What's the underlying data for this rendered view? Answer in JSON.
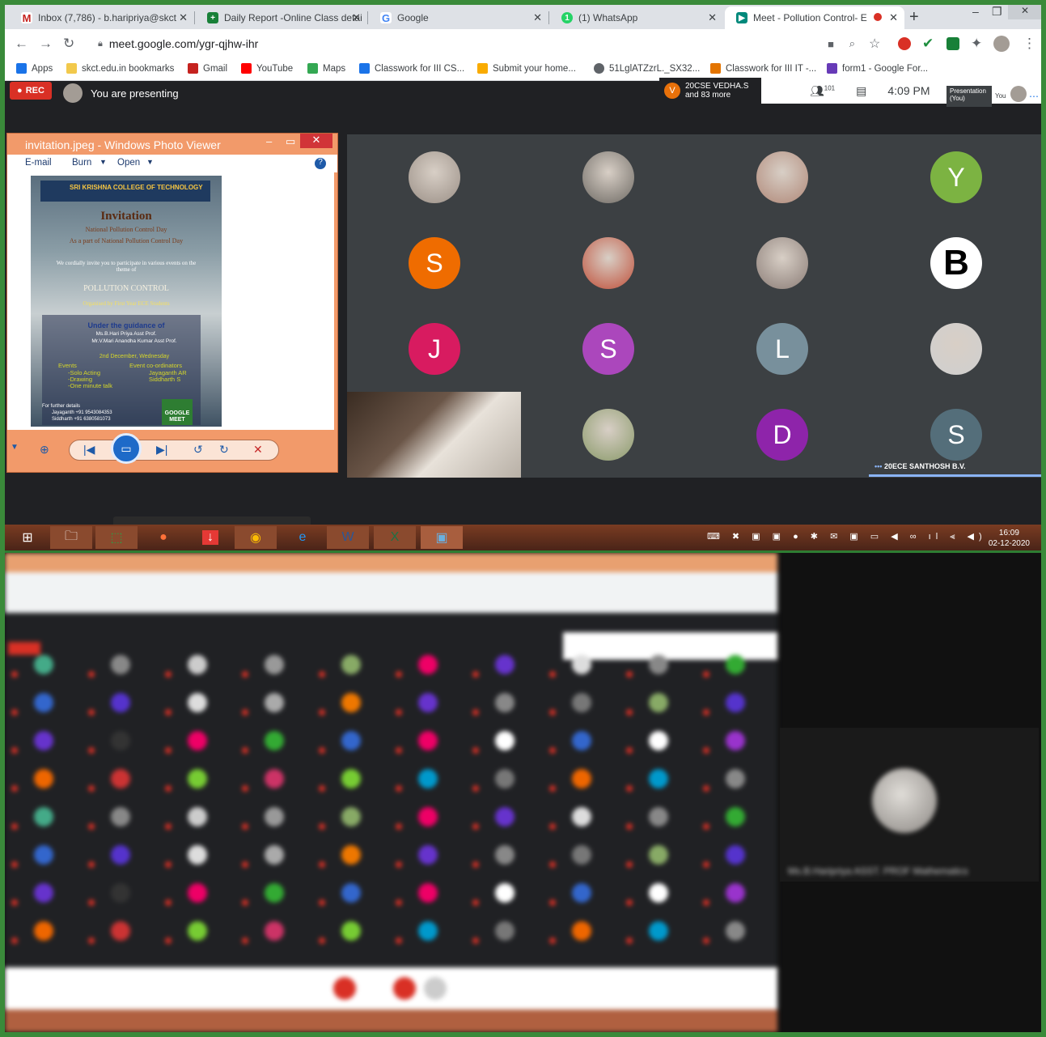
{
  "browser": {
    "tabs": [
      {
        "label": "Inbox (7,786) - b.haripriya@skct",
        "icon": "gmail-icon",
        "color": "#c5221f"
      },
      {
        "label": "Daily Report -Online Class detai",
        "icon": "sheets-icon",
        "color": "#188038"
      },
      {
        "label": "Google",
        "icon": "google-icon",
        "color": "#4285f4"
      },
      {
        "label": "(1) WhatsApp",
        "icon": "whatsapp-icon",
        "color": "#25d366"
      },
      {
        "label": "Meet - Pollution Control- E",
        "icon": "meet-icon",
        "color": "#00897b"
      }
    ],
    "url": "meet.google.com/ygr-qjhw-ihr",
    "bookmarks": [
      {
        "label": "Apps",
        "color": "#1a73e8"
      },
      {
        "label": "skct.edu.in bookmarks",
        "color": "#f2c94c"
      },
      {
        "label": "Gmail",
        "color": "#c5221f"
      },
      {
        "label": "YouTube",
        "color": "#ff0000"
      },
      {
        "label": "Maps",
        "color": "#34a853"
      },
      {
        "label": "Classwork for III CS...",
        "color": "#1a73e8"
      },
      {
        "label": "Submit your home...",
        "color": "#f9ab00"
      },
      {
        "label": "51LglATZzrL._SX32...",
        "color": "#5f6368"
      },
      {
        "label": "Classwork for III IT -...",
        "color": "#e37400"
      },
      {
        "label": "form1 - Google For...",
        "color": "#673ab7"
      }
    ]
  },
  "meet": {
    "rec_label": "REC",
    "presenting_label": "You are presenting",
    "speaker_name": "20CSE VEDHA.S",
    "speaker_more": "and 83 more",
    "speaker_initial": "V",
    "participant_count": "101",
    "time": "4:09  PM",
    "presentation_label": "Presentation (You)",
    "you_label": "You",
    "active_speaker_label": "20ECE SANTHOSH B.V.",
    "tiles": [
      {
        "type": "photo",
        "color": "#9a8f86"
      },
      {
        "type": "photo",
        "color": "#6e6a64"
      },
      {
        "type": "photo",
        "color": "#b08878"
      },
      {
        "type": "letter",
        "letter": "Y",
        "color": "#7cb342"
      },
      {
        "type": "letter",
        "letter": "S",
        "color": "#ef6c00"
      },
      {
        "type": "photo",
        "color": "#c0503a"
      },
      {
        "type": "photo",
        "color": "#8a7c76"
      },
      {
        "type": "letter",
        "letter": "B",
        "color": "#ffffff"
      },
      {
        "type": "letter",
        "letter": "J",
        "color": "#d81b60"
      },
      {
        "type": "letter",
        "letter": "S",
        "color": "#ab47bc"
      },
      {
        "type": "letter",
        "letter": "L",
        "color": "#78909c"
      },
      {
        "type": "photo",
        "color": "#cfcfcf"
      },
      {
        "type": "self",
        "color": ""
      },
      {
        "type": "photo",
        "color": "#8a9a6a"
      },
      {
        "type": "letter",
        "letter": "D",
        "color": "#8e24aa"
      },
      {
        "type": "letter",
        "letter": "S",
        "color": "#546e7a"
      }
    ]
  },
  "photo_viewer": {
    "title": "invitation.jpeg - Windows Photo Viewer",
    "menu": [
      "E-mail",
      "Burn",
      "Open"
    ],
    "poster": {
      "college": "SRI KRISHNA COLLEGE OF TECHNOLOGY",
      "heading": "Invitation",
      "line1": "National Pollution Control Day",
      "line2": "As a part of National Pollution Control Day",
      "line3": "We cordially invite you to participate in various events on the theme of",
      "theme": "POLLUTION CONTROL",
      "organised": "Organised by First Year ECE Students",
      "guidance": "Under the guidance of",
      "guide1": "Ms.B.Hari Priya Asst Prof.",
      "guide2": "Mr.V.Mari Anandha Kumar Asst Prof.",
      "date": "2nd December, Wednesday",
      "events_label": "Events",
      "events": [
        "-Solo Acting",
        "-Drawing",
        "-One minute talk"
      ],
      "coord_label": "Event co-ordinators",
      "coords": [
        "Jayaganth AR",
        "Siddharth S"
      ],
      "further": "For further details",
      "contact1": "Jayaganth +91 9543084353",
      "contact2": "Siddharth +91 6380581073",
      "meet_logo": "GOOGLE MEET"
    }
  },
  "taskbar": {
    "time": "16:09",
    "date": "02-12-2020"
  },
  "bottom_view": {
    "presenter_label": "Ms.B.Haripriya ASST. PROF Mathematics",
    "bottom_tile_colors": [
      "#4a8",
      "#888",
      "#ccc",
      "#999",
      "#8a6",
      "#e06",
      "#63c",
      "#ddd",
      "#888",
      "#3a3",
      "#36c",
      "#53c",
      "#ddd",
      "#aaa",
      "#e70",
      "#63c",
      "#888",
      "#777",
      "#8a6",
      "#53c",
      "#63c",
      "#333",
      "#e06",
      "#3a3",
      "#36c",
      "#e06",
      "#fff",
      "#36c",
      "#fff",
      "#93c",
      "#e60",
      "#c33",
      "#7c3",
      "#c36",
      "#7c3",
      "#09c",
      "#777",
      "#e60",
      "#09c",
      "#888"
    ]
  }
}
